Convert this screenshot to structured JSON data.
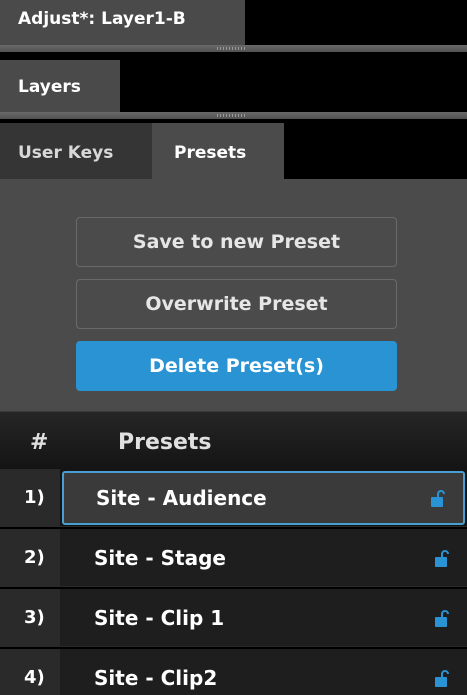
{
  "panels": {
    "adjust_title": "Adjust*: Layer1-B",
    "layers_title": "Layers"
  },
  "tabs": [
    {
      "label": "User Keys",
      "active": false
    },
    {
      "label": "Presets",
      "active": true
    }
  ],
  "actions": {
    "save_label": "Save to new Preset",
    "overwrite_label": "Overwrite Preset",
    "delete_label": "Delete Preset(s)"
  },
  "preset_list": {
    "header_hash": "#",
    "header_title": "Presets",
    "rows": [
      {
        "number": "1)",
        "name": "Site - Audience",
        "selected": true,
        "icon": "unlock-icon"
      },
      {
        "number": "2)",
        "name": "Site - Stage",
        "selected": false,
        "icon": "unlock-icon"
      },
      {
        "number": "3)",
        "name": "Site - Clip 1",
        "selected": false,
        "icon": "unlock-icon"
      },
      {
        "number": "4)",
        "name": "Site - Clip2",
        "selected": false,
        "icon": "unlock-icon"
      }
    ]
  },
  "colors": {
    "accent": "#2a93d3",
    "panel": "#4b4b4b",
    "background": "#000000"
  }
}
